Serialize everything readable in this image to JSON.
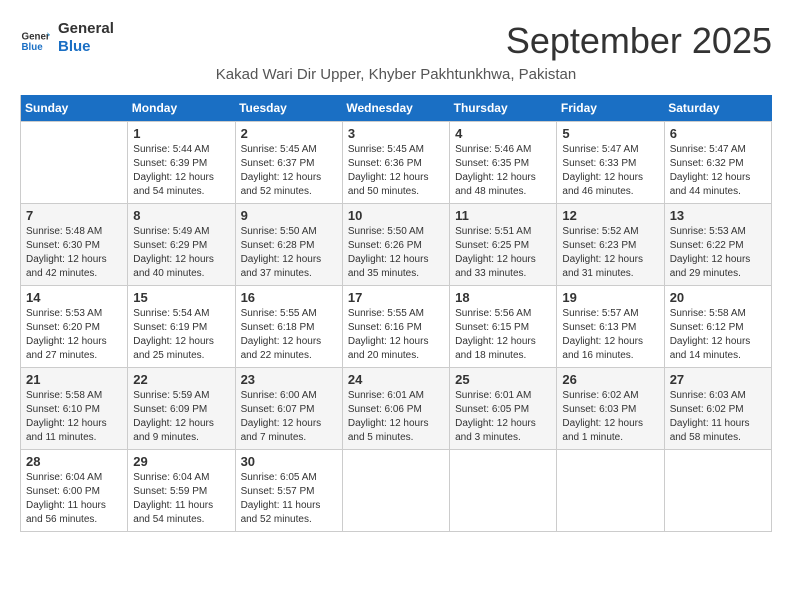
{
  "header": {
    "logo_line1": "General",
    "logo_line2": "Blue",
    "month_title": "September 2025",
    "subtitle": "Kakad Wari Dir Upper, Khyber Pakhtunkhwa, Pakistan"
  },
  "weekdays": [
    "Sunday",
    "Monday",
    "Tuesday",
    "Wednesday",
    "Thursday",
    "Friday",
    "Saturday"
  ],
  "weeks": [
    [
      {
        "day": "",
        "info": ""
      },
      {
        "day": "1",
        "info": "Sunrise: 5:44 AM\nSunset: 6:39 PM\nDaylight: 12 hours\nand 54 minutes."
      },
      {
        "day": "2",
        "info": "Sunrise: 5:45 AM\nSunset: 6:37 PM\nDaylight: 12 hours\nand 52 minutes."
      },
      {
        "day": "3",
        "info": "Sunrise: 5:45 AM\nSunset: 6:36 PM\nDaylight: 12 hours\nand 50 minutes."
      },
      {
        "day": "4",
        "info": "Sunrise: 5:46 AM\nSunset: 6:35 PM\nDaylight: 12 hours\nand 48 minutes."
      },
      {
        "day": "5",
        "info": "Sunrise: 5:47 AM\nSunset: 6:33 PM\nDaylight: 12 hours\nand 46 minutes."
      },
      {
        "day": "6",
        "info": "Sunrise: 5:47 AM\nSunset: 6:32 PM\nDaylight: 12 hours\nand 44 minutes."
      }
    ],
    [
      {
        "day": "7",
        "info": "Sunrise: 5:48 AM\nSunset: 6:30 PM\nDaylight: 12 hours\nand 42 minutes."
      },
      {
        "day": "8",
        "info": "Sunrise: 5:49 AM\nSunset: 6:29 PM\nDaylight: 12 hours\nand 40 minutes."
      },
      {
        "day": "9",
        "info": "Sunrise: 5:50 AM\nSunset: 6:28 PM\nDaylight: 12 hours\nand 37 minutes."
      },
      {
        "day": "10",
        "info": "Sunrise: 5:50 AM\nSunset: 6:26 PM\nDaylight: 12 hours\nand 35 minutes."
      },
      {
        "day": "11",
        "info": "Sunrise: 5:51 AM\nSunset: 6:25 PM\nDaylight: 12 hours\nand 33 minutes."
      },
      {
        "day": "12",
        "info": "Sunrise: 5:52 AM\nSunset: 6:23 PM\nDaylight: 12 hours\nand 31 minutes."
      },
      {
        "day": "13",
        "info": "Sunrise: 5:53 AM\nSunset: 6:22 PM\nDaylight: 12 hours\nand 29 minutes."
      }
    ],
    [
      {
        "day": "14",
        "info": "Sunrise: 5:53 AM\nSunset: 6:20 PM\nDaylight: 12 hours\nand 27 minutes."
      },
      {
        "day": "15",
        "info": "Sunrise: 5:54 AM\nSunset: 6:19 PM\nDaylight: 12 hours\nand 25 minutes."
      },
      {
        "day": "16",
        "info": "Sunrise: 5:55 AM\nSunset: 6:18 PM\nDaylight: 12 hours\nand 22 minutes."
      },
      {
        "day": "17",
        "info": "Sunrise: 5:55 AM\nSunset: 6:16 PM\nDaylight: 12 hours\nand 20 minutes."
      },
      {
        "day": "18",
        "info": "Sunrise: 5:56 AM\nSunset: 6:15 PM\nDaylight: 12 hours\nand 18 minutes."
      },
      {
        "day": "19",
        "info": "Sunrise: 5:57 AM\nSunset: 6:13 PM\nDaylight: 12 hours\nand 16 minutes."
      },
      {
        "day": "20",
        "info": "Sunrise: 5:58 AM\nSunset: 6:12 PM\nDaylight: 12 hours\nand 14 minutes."
      }
    ],
    [
      {
        "day": "21",
        "info": "Sunrise: 5:58 AM\nSunset: 6:10 PM\nDaylight: 12 hours\nand 11 minutes."
      },
      {
        "day": "22",
        "info": "Sunrise: 5:59 AM\nSunset: 6:09 PM\nDaylight: 12 hours\nand 9 minutes."
      },
      {
        "day": "23",
        "info": "Sunrise: 6:00 AM\nSunset: 6:07 PM\nDaylight: 12 hours\nand 7 minutes."
      },
      {
        "day": "24",
        "info": "Sunrise: 6:01 AM\nSunset: 6:06 PM\nDaylight: 12 hours\nand 5 minutes."
      },
      {
        "day": "25",
        "info": "Sunrise: 6:01 AM\nSunset: 6:05 PM\nDaylight: 12 hours\nand 3 minutes."
      },
      {
        "day": "26",
        "info": "Sunrise: 6:02 AM\nSunset: 6:03 PM\nDaylight: 12 hours\nand 1 minute."
      },
      {
        "day": "27",
        "info": "Sunrise: 6:03 AM\nSunset: 6:02 PM\nDaylight: 11 hours\nand 58 minutes."
      }
    ],
    [
      {
        "day": "28",
        "info": "Sunrise: 6:04 AM\nSunset: 6:00 PM\nDaylight: 11 hours\nand 56 minutes."
      },
      {
        "day": "29",
        "info": "Sunrise: 6:04 AM\nSunset: 5:59 PM\nDaylight: 11 hours\nand 54 minutes."
      },
      {
        "day": "30",
        "info": "Sunrise: 6:05 AM\nSunset: 5:57 PM\nDaylight: 11 hours\nand 52 minutes."
      },
      {
        "day": "",
        "info": ""
      },
      {
        "day": "",
        "info": ""
      },
      {
        "day": "",
        "info": ""
      },
      {
        "day": "",
        "info": ""
      }
    ]
  ]
}
